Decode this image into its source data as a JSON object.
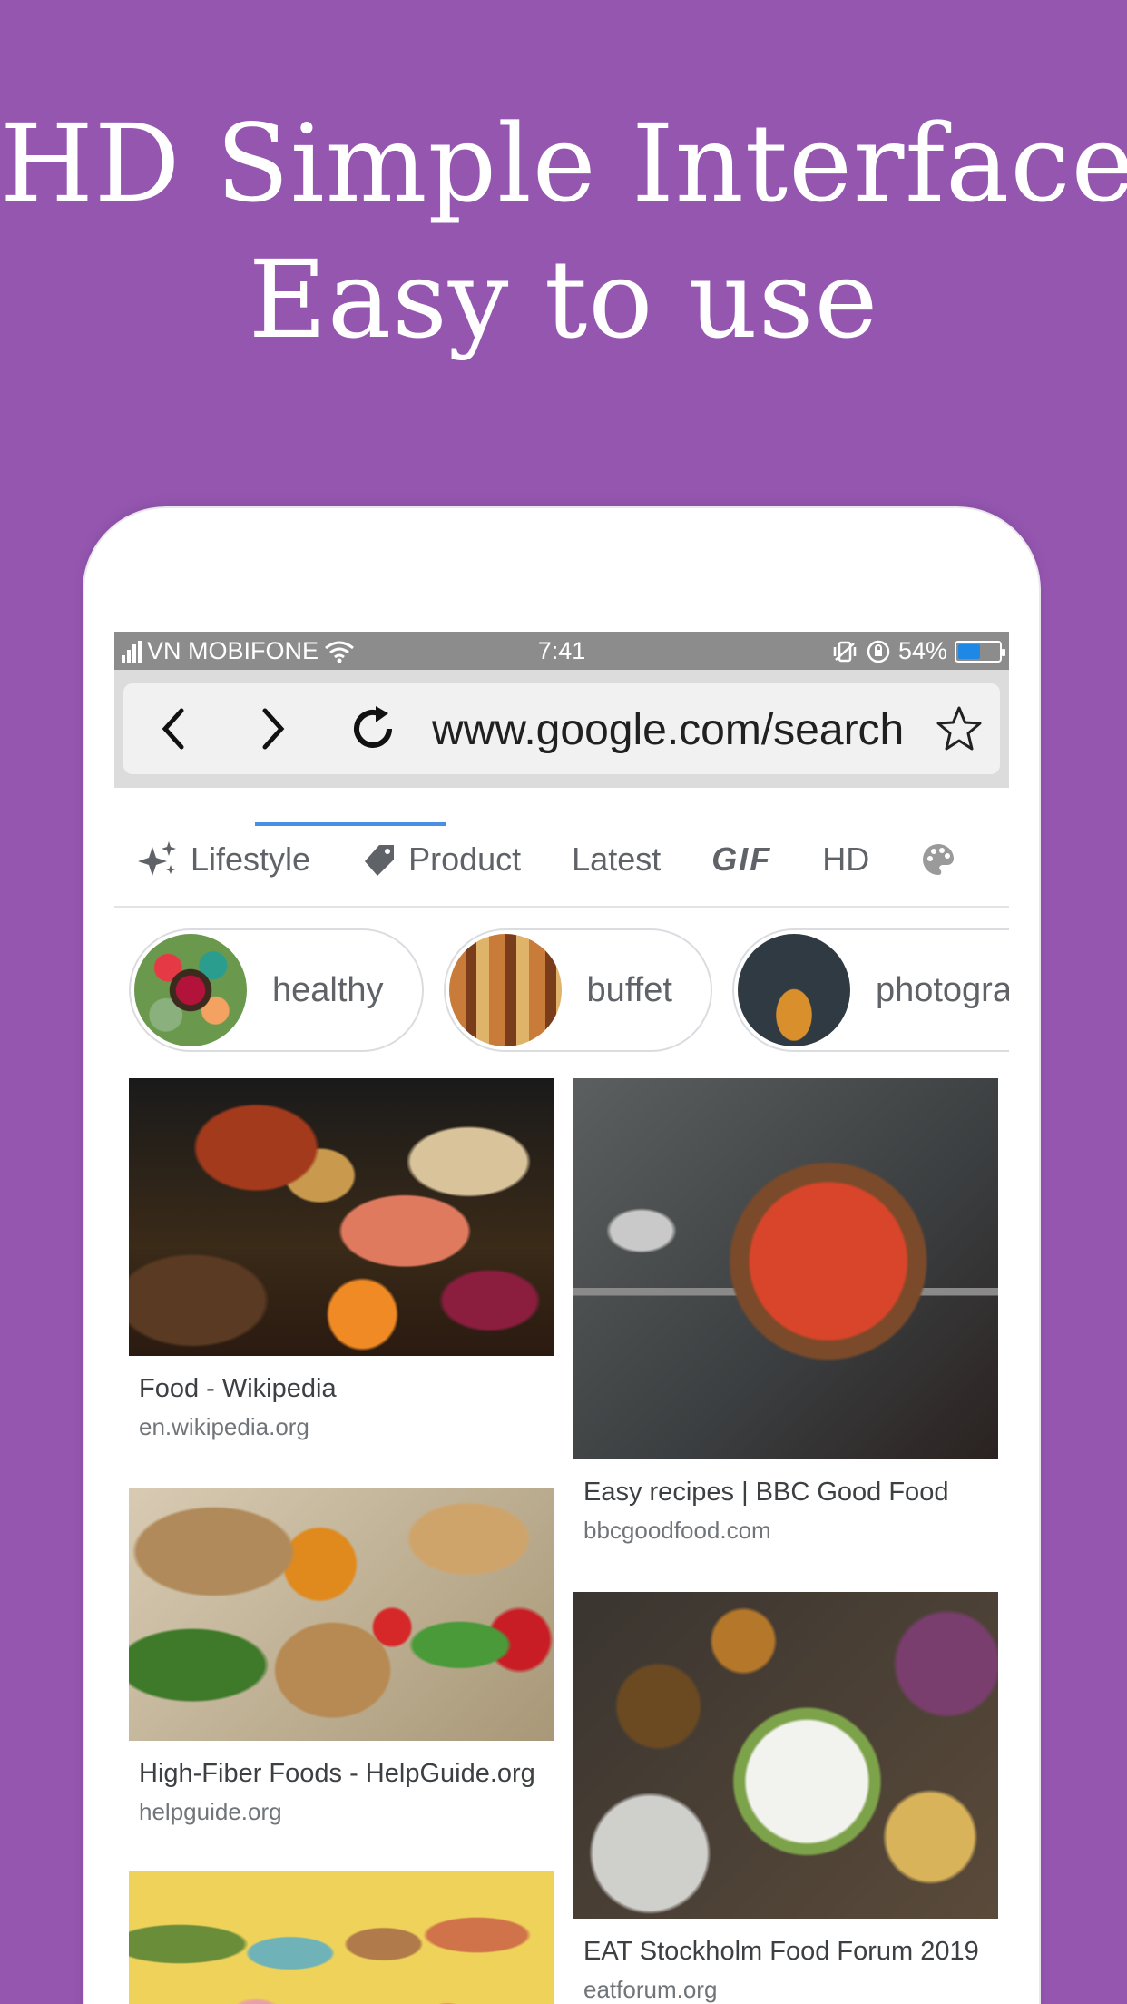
{
  "headline": {
    "line1": "HD Simple Interface",
    "line2": "Easy to use"
  },
  "status_bar": {
    "carrier": "VN MOBIFONE",
    "time": "7:41",
    "battery": "54%",
    "battery_level": 0.54
  },
  "browser": {
    "url": "www.google.com/search"
  },
  "tabs": [
    {
      "label": "Lifestyle",
      "icon": "sparkle-icon"
    },
    {
      "label": "Product",
      "icon": "tag-icon"
    },
    {
      "label": "Latest"
    },
    {
      "label": "GIF"
    },
    {
      "label": "HD"
    },
    {
      "label": "",
      "icon": "palette-icon"
    }
  ],
  "chips": [
    {
      "label": "healthy"
    },
    {
      "label": "buffet"
    },
    {
      "label": "photography"
    }
  ],
  "results": [
    {
      "title": "Food - Wikipedia",
      "domain": "en.wikipedia.org"
    },
    {
      "title": "Easy recipes | BBC Good Food",
      "domain": "bbcgoodfood.com"
    },
    {
      "title": "High-Fiber Foods - HelpGuide.org",
      "domain": "helpguide.org"
    },
    {
      "title": "EAT Stockholm Food Forum 2019",
      "domain": "eatforum.org"
    },
    {
      "title": "",
      "domain": ""
    }
  ],
  "colors": {
    "background": "#9556b0",
    "progress": "#4a90e2",
    "battery_fill": "#1e88e5"
  }
}
